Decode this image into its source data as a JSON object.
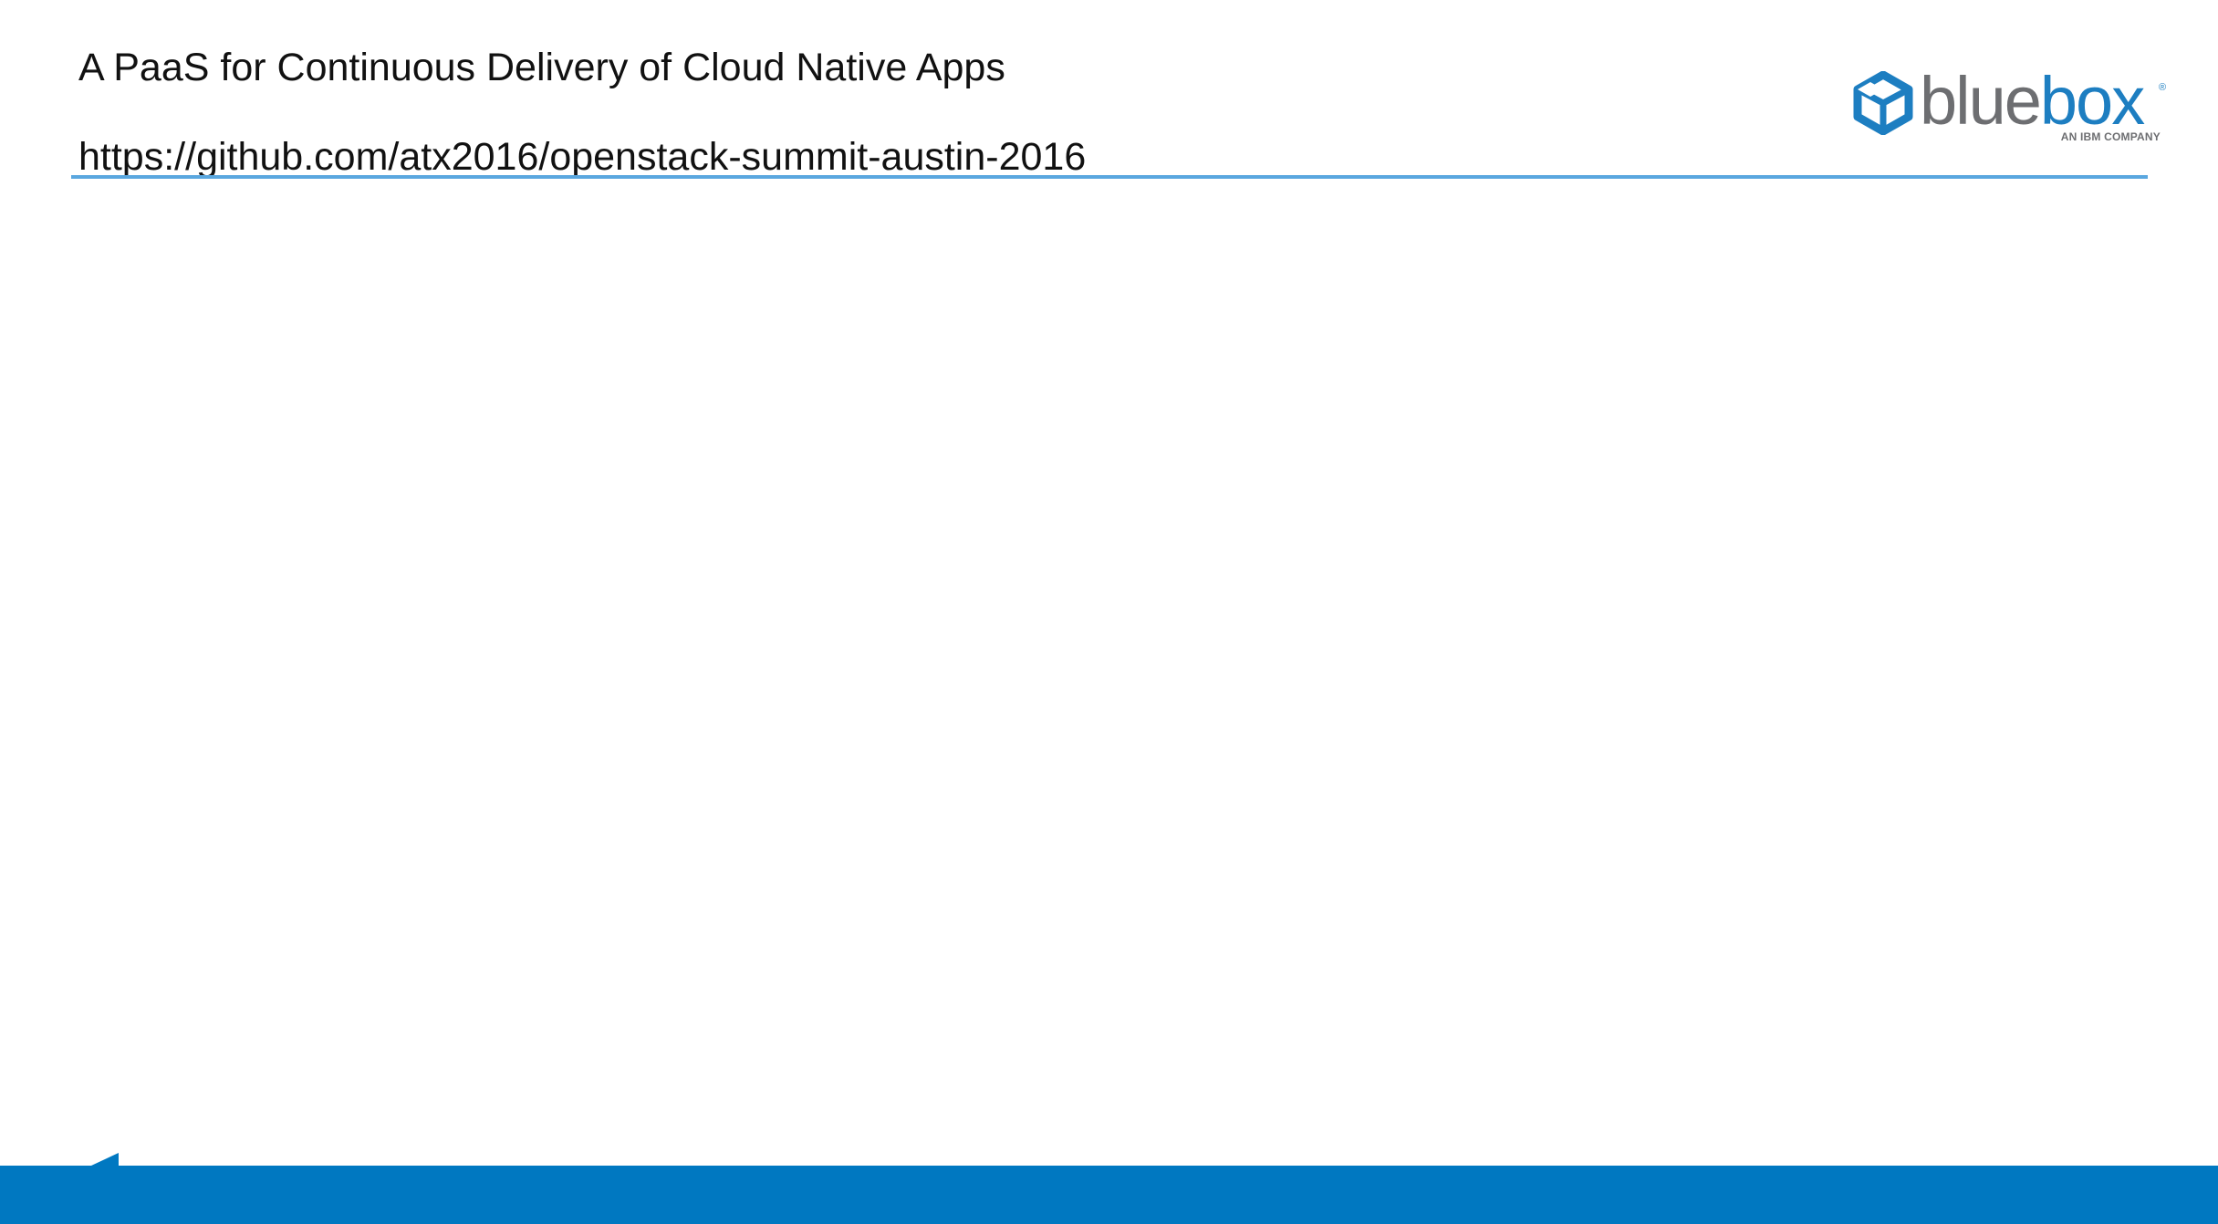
{
  "slide": {
    "title": "A PaaS for Continuous Delivery of Cloud Native Apps",
    "url": "https://github.com/atx2016/openstack-summit-austin-2016"
  },
  "logo": {
    "wordmark_part1": "blue",
    "wordmark_part2": "box",
    "registered_mark": "®",
    "tagline": "AN IBM COMPANY",
    "icon": "cube-logo-icon"
  },
  "colors": {
    "accent_blue": "#0078c1",
    "rule_blue": "#5aa7df",
    "logo_gray": "#6d6e71",
    "logo_blue": "#1d7ec1"
  }
}
